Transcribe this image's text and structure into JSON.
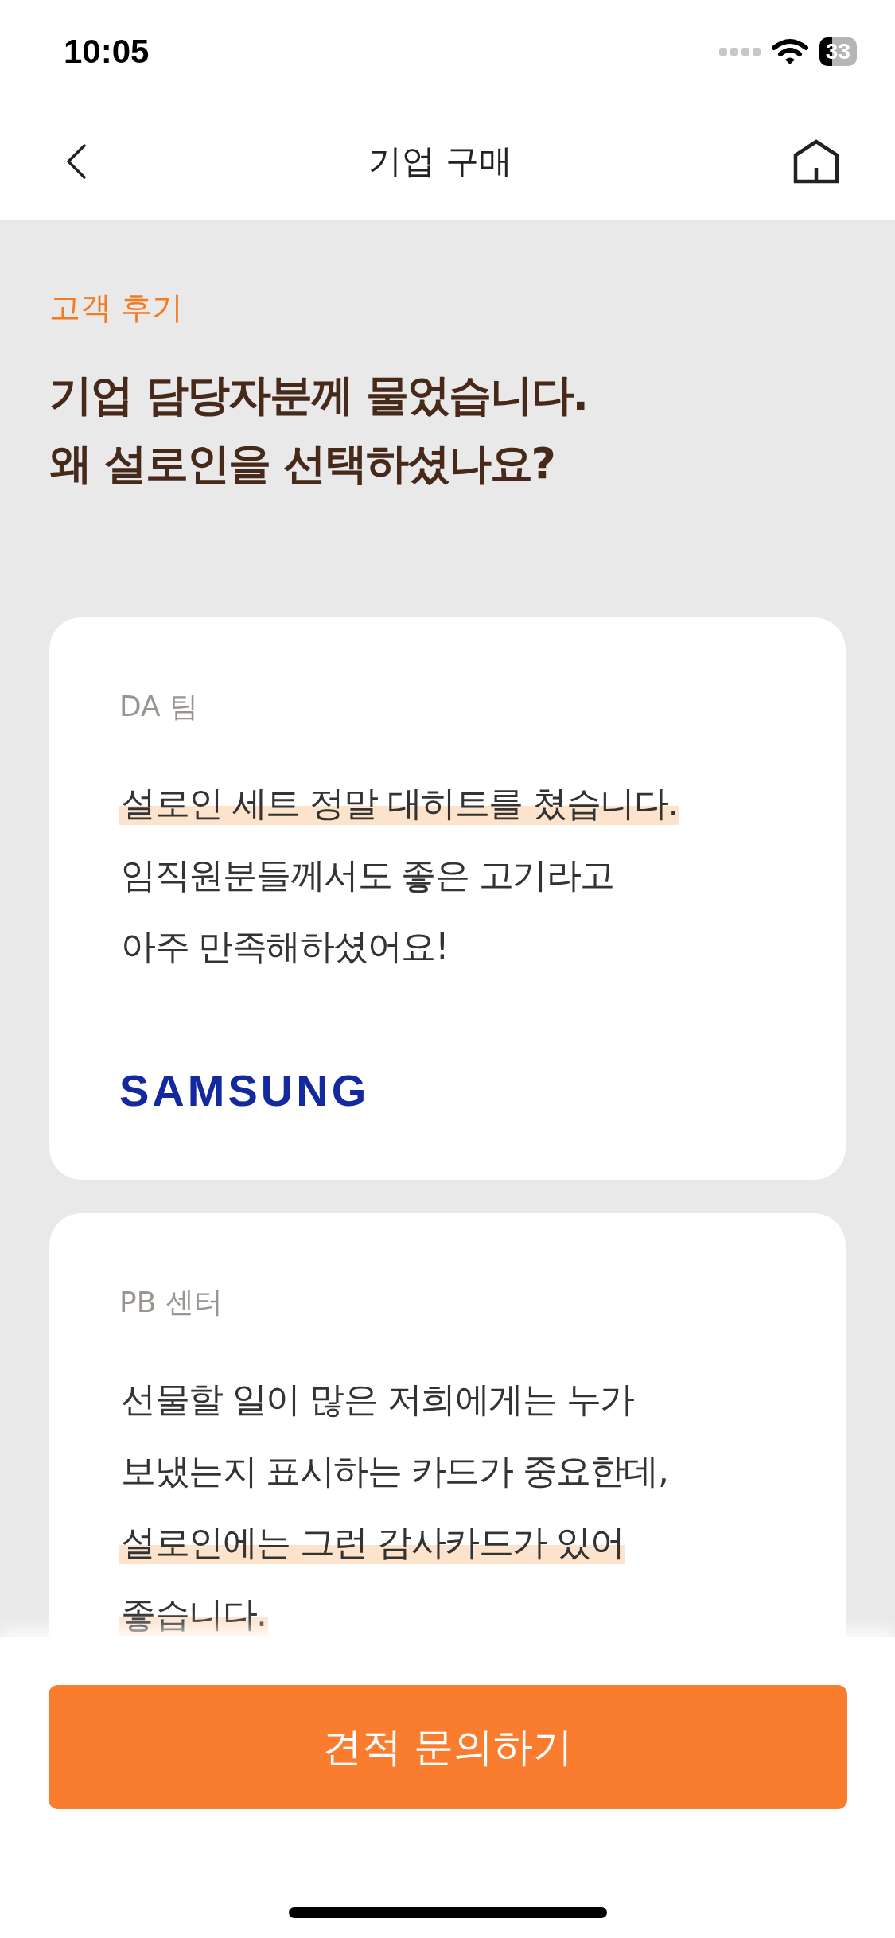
{
  "status_bar": {
    "time": "10:05",
    "battery": "33"
  },
  "nav": {
    "title": "기업 구매"
  },
  "section": {
    "eyebrow": "고객 후기",
    "headline": [
      "기업 담당자분께 물었습니다.",
      "왜 설로인을 선택하셨나요?"
    ]
  },
  "reviews": [
    {
      "team": "DA 팀",
      "lines": [
        {
          "text": "설로인 세트 정말 대히트를 쳤습니다.",
          "highlight": true
        },
        {
          "text": "임직원분들께서도 좋은 고기라고",
          "highlight": false
        },
        {
          "text": "아주 만족해하셨어요!",
          "highlight": false
        }
      ],
      "logo": "SAMSUNG"
    },
    {
      "team": "PB 센터",
      "lines": [
        {
          "text": "선물할 일이 많은 저희에게는 누가",
          "highlight": false
        },
        {
          "text": "보냈는지 표시하는 카드가 중요한데,",
          "highlight": false
        },
        {
          "text": "설로인에는 그런 감사카드가 있어",
          "highlight": true
        },
        {
          "text": "좋습니다.",
          "highlight": true
        }
      ]
    }
  ],
  "cta": {
    "label": "견적 문의하기"
  }
}
